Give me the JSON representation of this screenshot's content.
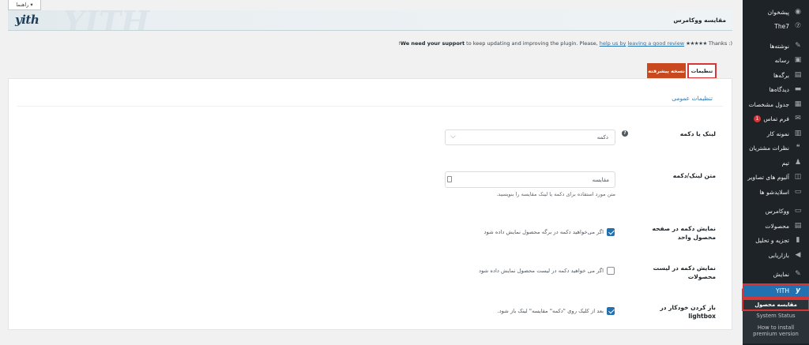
{
  "help_tab": {
    "label": "راهنما"
  },
  "header": {
    "logo": "yith",
    "ghost": "YITH",
    "title": "مقایسه ووکامرس"
  },
  "notice": {
    "prefix": "Thanks :) ",
    "stars": "★★★★★",
    "link1": "leaving a good review",
    "middle": " ",
    "link2": "help us by",
    "text": " We need your support to keep updating and improving the plugin. Please,",
    "strong": "We need your support",
    "rest": " to keep updating and improving the plugin. Please, ",
    "end": "!"
  },
  "tabs": {
    "settings": "تنظیمات",
    "premium": "نسخه پیشرفته"
  },
  "section": {
    "title": "تنظیمات عمومی"
  },
  "fields": {
    "link_or_button": {
      "label": "لینک یا دکمه",
      "value": "دکمه"
    },
    "link_text": {
      "label": "متن لینک/دکمه",
      "value": "مقایسه",
      "description": "متن مورد استفاده برای دکمه یا لینک مقایسه را بنویسید."
    },
    "show_single": {
      "label": "نمایش دکمه در صفحه محصول واحد",
      "text": "اگر می‌خواهید دکمه در برگه محصول نمایش داده شود",
      "checked": true
    },
    "show_list": {
      "label": "نمایش دکمه در لیست محصولات",
      "text": "اگر می خواهید دکمه در لیست محصول نمایش داده شود",
      "checked": false
    },
    "auto_lightbox": {
      "label": "باز کردن خودکار در lightbox",
      "text": "بعد از کلیک روی \"دکمه\" مقایسه\" لینک باز شود.",
      "checked": true
    }
  },
  "sidebar": {
    "items": [
      {
        "label": "پیشخوان",
        "icon": "dashboard-icon",
        "glyph": "◉"
      },
      {
        "label": "The7",
        "icon": "the7-icon",
        "glyph": "⑦"
      },
      {
        "label": "نوشته‌ها",
        "icon": "pin-icon",
        "glyph": "✎"
      },
      {
        "label": "رسانه",
        "icon": "media-icon",
        "glyph": "▣"
      },
      {
        "label": "برگه‌ها",
        "icon": "pages-icon",
        "glyph": "▤"
      },
      {
        "label": "دیدگاه‌ها",
        "icon": "comments-icon",
        "glyph": "▬"
      },
      {
        "label": "جدول مشخصات",
        "icon": "table-icon",
        "glyph": "▦"
      },
      {
        "label": "فرم تماس",
        "icon": "mail-icon",
        "glyph": "✉",
        "badge": "1"
      },
      {
        "label": "نمونه کار",
        "icon": "portfolio-icon",
        "glyph": "▥"
      },
      {
        "label": "نظرات مشتریان",
        "icon": "testimonials-icon",
        "glyph": "❝"
      },
      {
        "label": "تیم",
        "icon": "team-icon",
        "glyph": "♟"
      },
      {
        "label": "آلبوم های تصاویر",
        "icon": "gallery-icon",
        "glyph": "◫"
      },
      {
        "label": "اسلایدشو ها",
        "icon": "slideshow-icon",
        "glyph": "▭"
      },
      {
        "label": "ووکامرس",
        "icon": "woocommerce-icon",
        "glyph": "▭"
      },
      {
        "label": "محصولات",
        "icon": "products-icon",
        "glyph": "▤"
      },
      {
        "label": "تجزیه و تحلیل",
        "icon": "analytics-icon",
        "glyph": "▮"
      },
      {
        "label": "بازاریابی",
        "icon": "marketing-icon",
        "glyph": "◀"
      },
      {
        "label": "نمایش",
        "icon": "appearance-icon",
        "glyph": "✎"
      }
    ],
    "yith": {
      "label": "YITH",
      "glyph": "y"
    },
    "submenu": [
      "مقایسه محصول",
      "System Status",
      "How to install premium version"
    ]
  }
}
